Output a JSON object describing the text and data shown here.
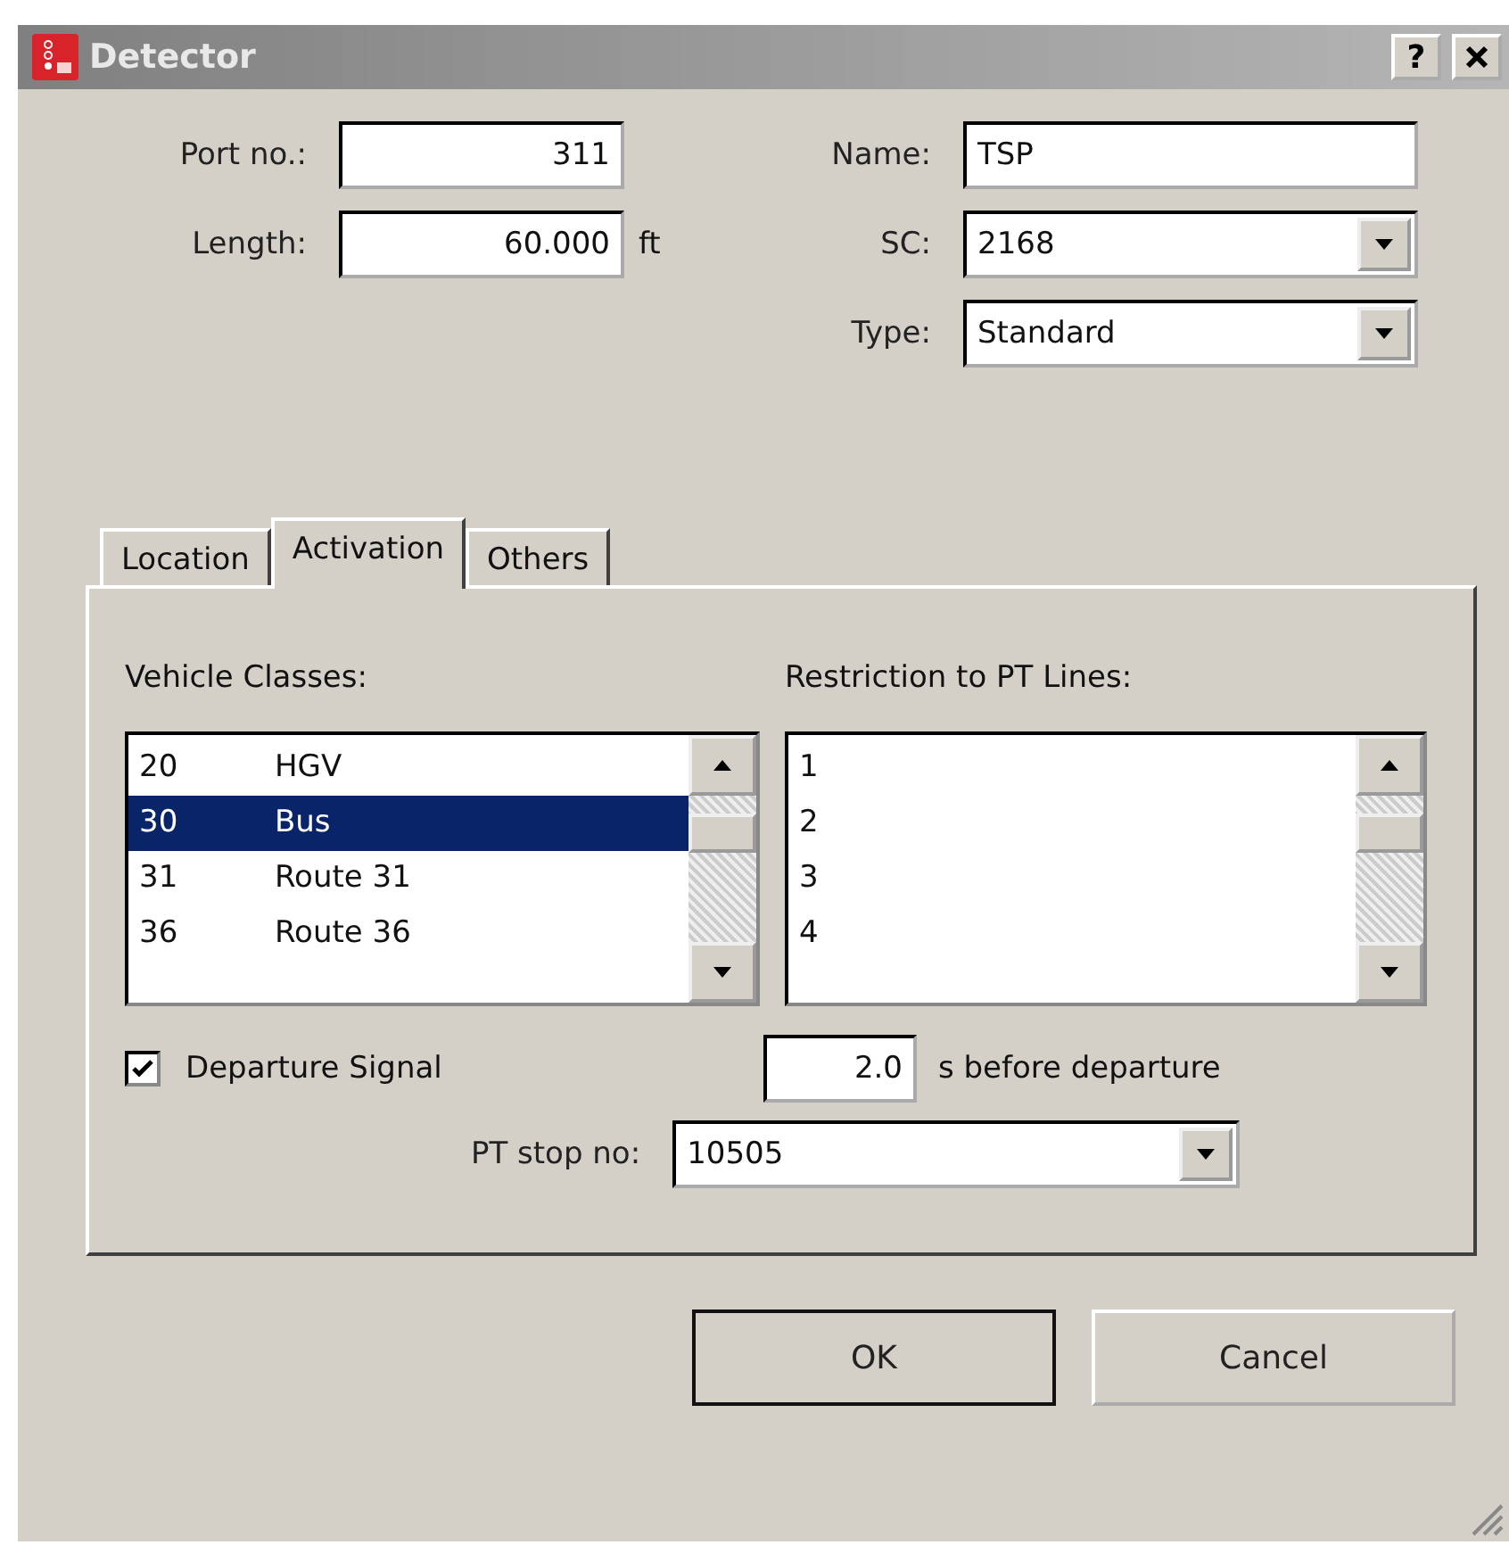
{
  "window": {
    "title": "Detector",
    "help": "?"
  },
  "fields": {
    "port": {
      "label": "Port no.:",
      "value": "311"
    },
    "length": {
      "label": "Length:",
      "value": "60.000",
      "unit": "ft"
    },
    "name": {
      "label": "Name:",
      "value": "TSP"
    },
    "sc": {
      "label": "SC:",
      "value": "2168"
    },
    "type": {
      "label": "Type:",
      "value": "Standard"
    }
  },
  "tabs": [
    {
      "label": "Location",
      "selected": false
    },
    {
      "label": "Activation",
      "selected": true
    },
    {
      "label": "Others",
      "selected": false
    }
  ],
  "vehicle_classes": {
    "label": "Vehicle Classes:",
    "rows": [
      {
        "number": "20",
        "name": "HGV",
        "selected": false
      },
      {
        "number": "30",
        "name": "Bus",
        "selected": true
      },
      {
        "number": "31",
        "name": "Route 31",
        "selected": false
      },
      {
        "number": "36",
        "name": "Route 36",
        "selected": false
      }
    ]
  },
  "pt_lines": {
    "label": "Restriction to PT Lines:",
    "rows": [
      {
        "number": "1",
        "selected": false
      },
      {
        "number": "2",
        "selected": false
      },
      {
        "number": "3",
        "selected": false
      },
      {
        "number": "4",
        "selected": false
      }
    ]
  },
  "departure_signal": {
    "label": "Departure Signal",
    "checked": true
  },
  "delay": {
    "value": "2.0",
    "unit": "s before departure"
  },
  "pt_stop": {
    "label": "PT stop no:",
    "value": "10505"
  },
  "buttons": [
    {
      "label": "OK",
      "default": true
    },
    {
      "label": "Cancel",
      "default": false
    }
  ]
}
